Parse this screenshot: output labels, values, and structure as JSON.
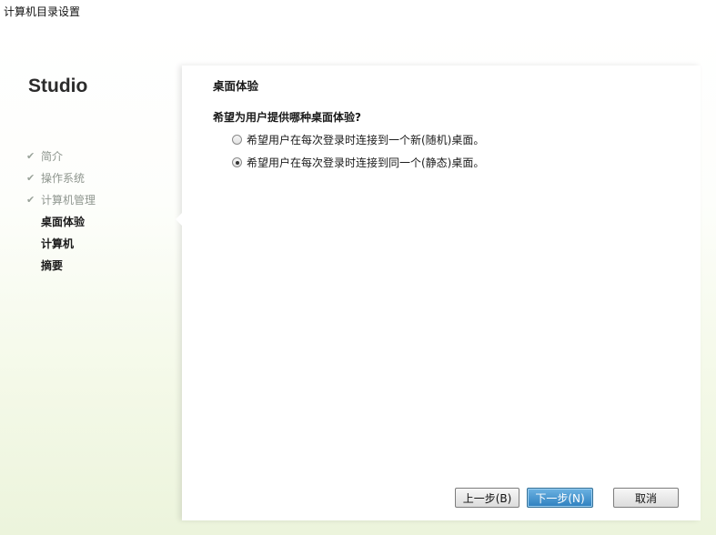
{
  "window": {
    "title": "计算机目录设置"
  },
  "sidebar": {
    "brand": "Studio",
    "steps": [
      {
        "label": "简介",
        "state": "done"
      },
      {
        "label": "操作系统",
        "state": "done"
      },
      {
        "label": "计算机管理",
        "state": "done"
      },
      {
        "label": "桌面体验",
        "state": "current"
      },
      {
        "label": "计算机",
        "state": "pending"
      },
      {
        "label": "摘要",
        "state": "pending"
      }
    ],
    "check_glyph": "✔"
  },
  "main": {
    "section_title": "桌面体验",
    "question": "希望为用户提供哪种桌面体验?",
    "options": [
      {
        "label": "希望用户在每次登录时连接到一个新(随机)桌面。",
        "selected": false
      },
      {
        "label": "希望用户在每次登录时连接到同一个(静态)桌面。",
        "selected": true
      }
    ]
  },
  "footer": {
    "back_label": "上一步(B)",
    "next_label": "下一步(N)",
    "cancel_label": "取消"
  },
  "colors": {
    "primary_button": "#2e80bf",
    "background_tint": "#ecf4dc"
  }
}
